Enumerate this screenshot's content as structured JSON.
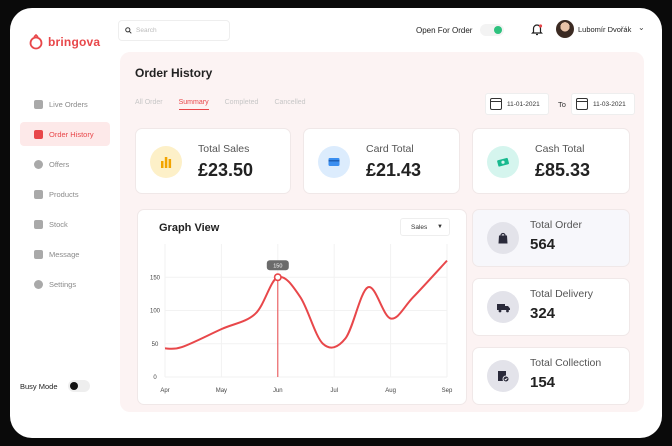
{
  "app": {
    "brand": "bringova"
  },
  "sidebar": {
    "items": [
      {
        "label": "Live Orders",
        "icon": "grid-icon"
      },
      {
        "label": "Order History",
        "icon": "bag-icon",
        "active": true
      },
      {
        "label": "Offers",
        "icon": "tag-icon"
      },
      {
        "label": "Products",
        "icon": "box-icon"
      },
      {
        "label": "Stock",
        "icon": "store-icon"
      },
      {
        "label": "Message",
        "icon": "chat-icon"
      },
      {
        "label": "Settings",
        "icon": "gear-icon"
      }
    ],
    "busy_mode_label": "Busy Mode",
    "busy_mode_on": false
  },
  "topbar": {
    "search_placeholder": "Search",
    "open_label": "Open For Order",
    "open_on": true,
    "user_name": "Lubomír Dvořák"
  },
  "main": {
    "title": "Order History",
    "tabs": [
      {
        "label": "All Order"
      },
      {
        "label": "Summary",
        "active": true
      },
      {
        "label": "Completed"
      },
      {
        "label": "Cancelled"
      }
    ],
    "date_from": "11-01-2021",
    "date_to_label": "To",
    "date_to": "11-03-2021"
  },
  "stats": {
    "total_sales": {
      "label": "Total Sales",
      "value": "£23.50"
    },
    "card_total": {
      "label": "Card Total",
      "value": "£21.43"
    },
    "cash_total": {
      "label": "Cash Total",
      "value": "£85.33"
    },
    "total_order": {
      "label": "Total Order",
      "value": "564"
    },
    "total_delivery": {
      "label": "Total Delivery",
      "value": "324"
    },
    "total_collection": {
      "label": "Total Collection",
      "value": "154"
    }
  },
  "graph": {
    "title": "Graph View",
    "dropdown_value": "Sales",
    "tooltip": "150"
  },
  "colors": {
    "accent": "#e8474a",
    "status_on": "#2ec27e"
  },
  "chart_data": {
    "type": "line",
    "x": [
      "Apr",
      "May",
      "Jun",
      "Jul",
      "Aug",
      "Sep"
    ],
    "yticks": [
      0,
      50,
      100,
      150
    ],
    "ylim": [
      0,
      200
    ],
    "series": [
      {
        "points": [
          {
            "x": 0.0,
            "y": 43
          },
          {
            "x": 0.3,
            "y": 45
          },
          {
            "x": 1.0,
            "y": 72
          },
          {
            "x": 1.6,
            "y": 95
          },
          {
            "x": 2.0,
            "y": 150
          },
          {
            "x": 2.4,
            "y": 120
          },
          {
            "x": 2.8,
            "y": 50
          },
          {
            "x": 3.2,
            "y": 58
          },
          {
            "x": 3.6,
            "y": 135
          },
          {
            "x": 4.0,
            "y": 88
          },
          {
            "x": 4.4,
            "y": 120
          },
          {
            "x": 5.0,
            "y": 175
          }
        ],
        "highlight": {
          "x": 2.0,
          "y": 150
        }
      }
    ],
    "grid": true
  }
}
